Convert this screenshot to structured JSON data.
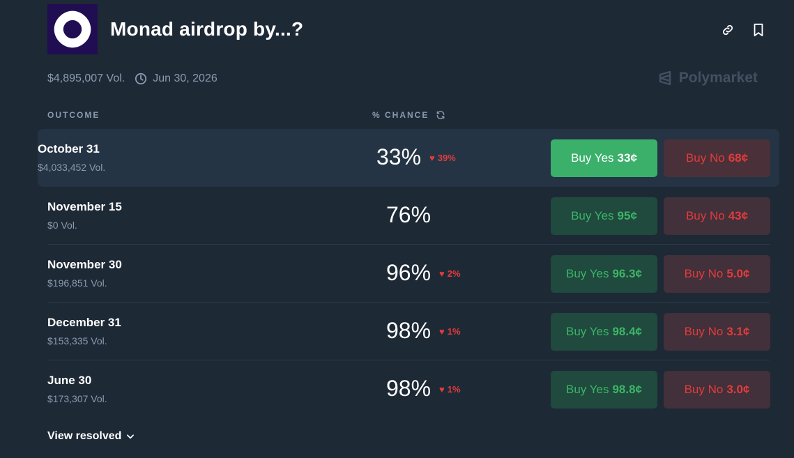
{
  "header": {
    "title": "Monad airdrop by...?",
    "volume": "$4,895,007 Vol.",
    "end_date": "Jun 30, 2026",
    "brand": "Polymarket"
  },
  "table": {
    "col_outcome": "OUTCOME",
    "col_chance": "% CHANCE"
  },
  "rows": [
    {
      "label": "October 31",
      "volume": "$4,033,452 Vol.",
      "chance": "33%",
      "delta": "39%",
      "yes_label": "Buy Yes",
      "yes_price": "33¢",
      "no_label": "Buy No",
      "no_price": "68¢"
    },
    {
      "label": "November 15",
      "volume": "$0 Vol.",
      "chance": "76%",
      "delta": "",
      "yes_label": "Buy Yes",
      "yes_price": "95¢",
      "no_label": "Buy No",
      "no_price": "43¢"
    },
    {
      "label": "November 30",
      "volume": "$196,851 Vol.",
      "chance": "96%",
      "delta": "2%",
      "yes_label": "Buy Yes",
      "yes_price": "96.3¢",
      "no_label": "Buy No",
      "no_price": "5.0¢"
    },
    {
      "label": "December 31",
      "volume": "$153,335 Vol.",
      "chance": "98%",
      "delta": "1%",
      "yes_label": "Buy Yes",
      "yes_price": "98.4¢",
      "no_label": "Buy No",
      "no_price": "3.1¢"
    },
    {
      "label": "June 30",
      "volume": "$173,307 Vol.",
      "chance": "98%",
      "delta": "1%",
      "yes_label": "Buy Yes",
      "yes_price": "98.8¢",
      "no_label": "Buy No",
      "no_price": "3.0¢"
    }
  ],
  "footer": {
    "view_resolved": "View resolved"
  },
  "colors": {
    "yes": "#3ab06a",
    "no": "#e23c3c",
    "background": "#1e2936"
  }
}
